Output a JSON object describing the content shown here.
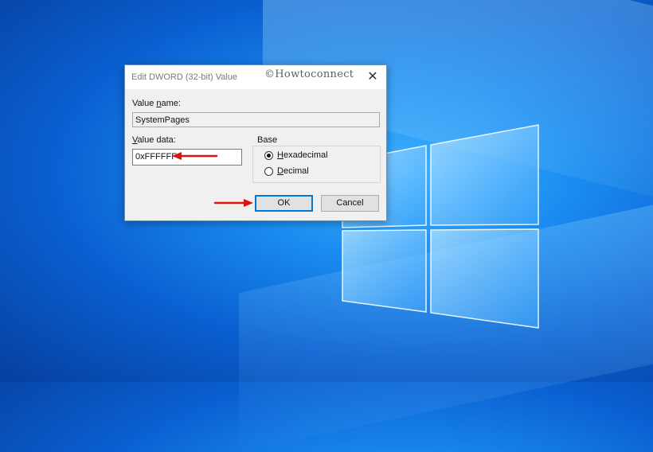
{
  "dialog": {
    "title": "Edit DWORD (32-bit) Value",
    "watermark": "©Howtoconnect",
    "close_glyph": "✕",
    "value_name_label_prefix": "Value ",
    "value_name_label_underlined": "n",
    "value_name_label_suffix": "ame:",
    "value_name": "SystemPages",
    "value_data_label_underlined": "V",
    "value_data_label_suffix": "alue data:",
    "value_data": "0xFFFFFF",
    "base_label": "Base",
    "radio_hex_underlined": "H",
    "radio_hex_suffix": "exadecimal",
    "radio_dec_underlined": "D",
    "radio_dec_suffix": "ecimal",
    "selected_base": "Hexadecimal",
    "ok_label": "OK",
    "cancel_label": "Cancel"
  },
  "colors": {
    "arrow": "#e01010",
    "default_button_border": "#0078d7"
  },
  "icons": [
    "close-icon",
    "arrow-icon",
    "windows-logo"
  ]
}
